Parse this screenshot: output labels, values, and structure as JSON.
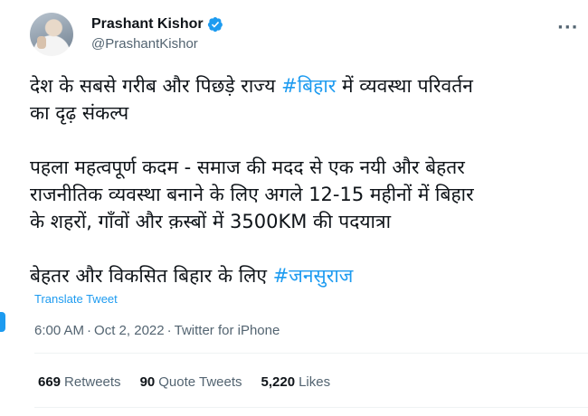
{
  "author": {
    "display_name": "Prashant Kishor",
    "handle": "@PrashantKishor"
  },
  "tweet": {
    "line1": "देश के सबसे गरीब और पिछड़े राज्य ",
    "hashtag1": "#बिहार",
    "line1_rest": " में व्यवस्था परिवर्तन",
    "line2": "का दृढ़ संकल्प",
    "line3": "पहला महत्वपूर्ण कदम - समाज की मदद से एक नयी और बेहतर",
    "line4": "राजनीतिक व्यवस्था बनाने के लिए अगले 12-15 महीनों में बिहार",
    "line5": "के शहरों, गाँवों और क़स्बों में 3500KM की पदयात्रा",
    "line6": "बेहतर और विकसित बिहार के लिए ",
    "hashtag2": "#जनसुराज"
  },
  "translate_label": "Translate Tweet",
  "meta": {
    "time": "6:00 AM",
    "separator": "·",
    "date": "Oct 2, 2022",
    "source": "Twitter for iPhone"
  },
  "stats": {
    "retweets_count": "669",
    "retweets_label": "Retweets",
    "quotes_count": "90",
    "quotes_label": "Quote Tweets",
    "likes_count": "5,220",
    "likes_label": "Likes"
  },
  "colors": {
    "accent": "#1d9bf0",
    "secondary_text": "#536471",
    "primary_text": "#0f1419"
  },
  "icons": [
    "verified-badge-icon",
    "more-options-icon"
  ]
}
